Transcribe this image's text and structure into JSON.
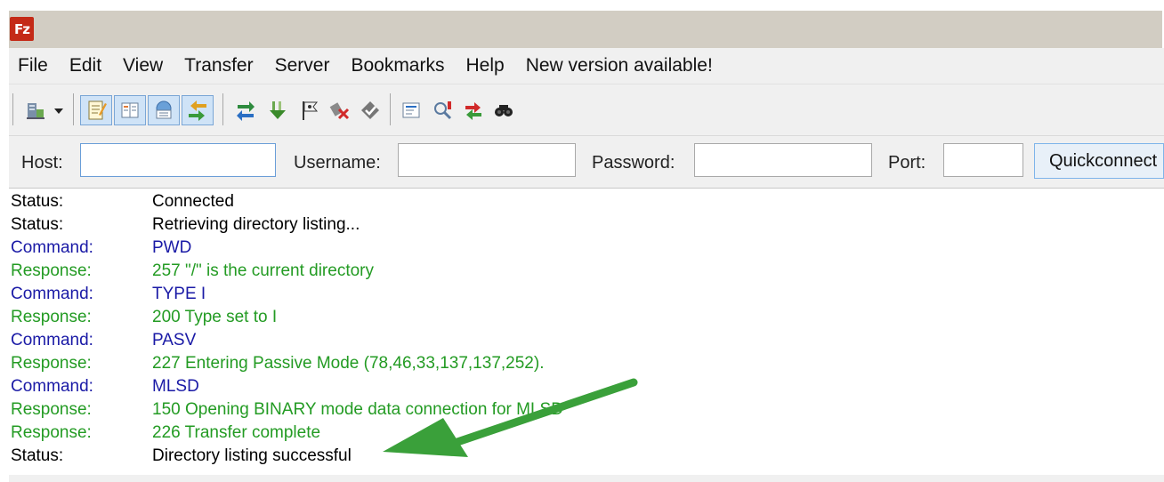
{
  "titlebar": {
    "logo_text": "Fz"
  },
  "menu": [
    "File",
    "Edit",
    "View",
    "Transfer",
    "Server",
    "Bookmarks",
    "Help",
    "New version available!"
  ],
  "toolbar": {
    "buttons": [
      "site-manager-icon",
      "dropdown-arrow-icon",
      "message-log-icon",
      "directory-tree-icon",
      "remote-tree-icon",
      "transfer-queue-icon",
      "refresh-icon",
      "process-queue-icon",
      "cancel-flag-icon",
      "disconnect-icon",
      "reconnect-icon",
      "directory-listing-filter-icon",
      "toggle-sync-browse-icon",
      "compare-dirs-icon",
      "search-icon"
    ]
  },
  "quickconnect": {
    "host_label": "Host:",
    "host_value": "",
    "username_label": "Username:",
    "username_value": "",
    "password_label": "Password:",
    "password_value": "",
    "port_label": "Port:",
    "port_value": "",
    "button_label": "Quickconnect"
  },
  "log": [
    {
      "type": "Status:",
      "message": "Connected",
      "kind": "status"
    },
    {
      "type": "Status:",
      "message": "Retrieving directory listing...",
      "kind": "status"
    },
    {
      "type": "Command:",
      "message": "PWD",
      "kind": "command"
    },
    {
      "type": "Response:",
      "message": "257 \"/\" is the current directory",
      "kind": "response"
    },
    {
      "type": "Command:",
      "message": "TYPE I",
      "kind": "command"
    },
    {
      "type": "Response:",
      "message": "200 Type set to I",
      "kind": "response"
    },
    {
      "type": "Command:",
      "message": "PASV",
      "kind": "command"
    },
    {
      "type": "Response:",
      "message": "227 Entering Passive Mode (78,46,33,137,137,252).",
      "kind": "response"
    },
    {
      "type": "Command:",
      "message": "MLSD",
      "kind": "command"
    },
    {
      "type": "Response:",
      "message": "150 Opening BINARY mode data connection for MLSD",
      "kind": "response"
    },
    {
      "type": "Response:",
      "message": "226 Transfer complete",
      "kind": "response"
    },
    {
      "type": "Status:",
      "message": "Directory listing successful",
      "kind": "status"
    }
  ],
  "colors": {
    "status": "#000000",
    "command": "#1a1aa6",
    "response": "#239b23",
    "annotation_arrow": "#3aa03a",
    "logo_background": "#c42a17"
  }
}
